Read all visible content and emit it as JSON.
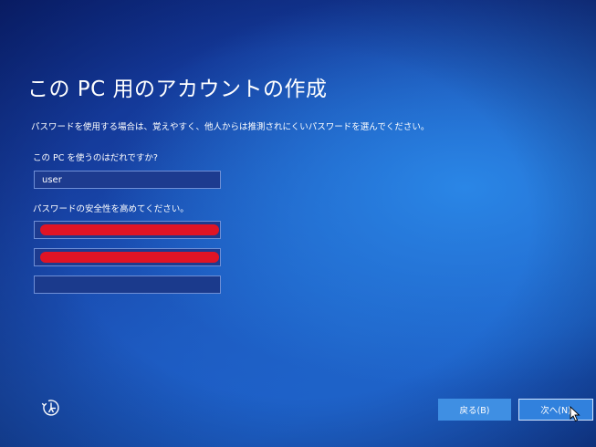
{
  "page": {
    "title": "この PC 用のアカウントの作成",
    "description": "パスワードを使用する場合は、覚えやすく、他人からは推測されにくいパスワードを選んでください。"
  },
  "username": {
    "label": "この PC を使うのはだれですか?",
    "value": "user"
  },
  "password": {
    "label": "パスワードの安全性を高めてください。"
  },
  "buttons": {
    "back_label": "戻る(B)",
    "next_label": "次へ(N)"
  },
  "icons": {
    "accessibility": "ease-of-access-icon",
    "cursor": "mouse-cursor-icon"
  },
  "colors": {
    "redaction": "#e01425",
    "button_back": "#3f8fe3",
    "button_next": "#3181dd"
  }
}
